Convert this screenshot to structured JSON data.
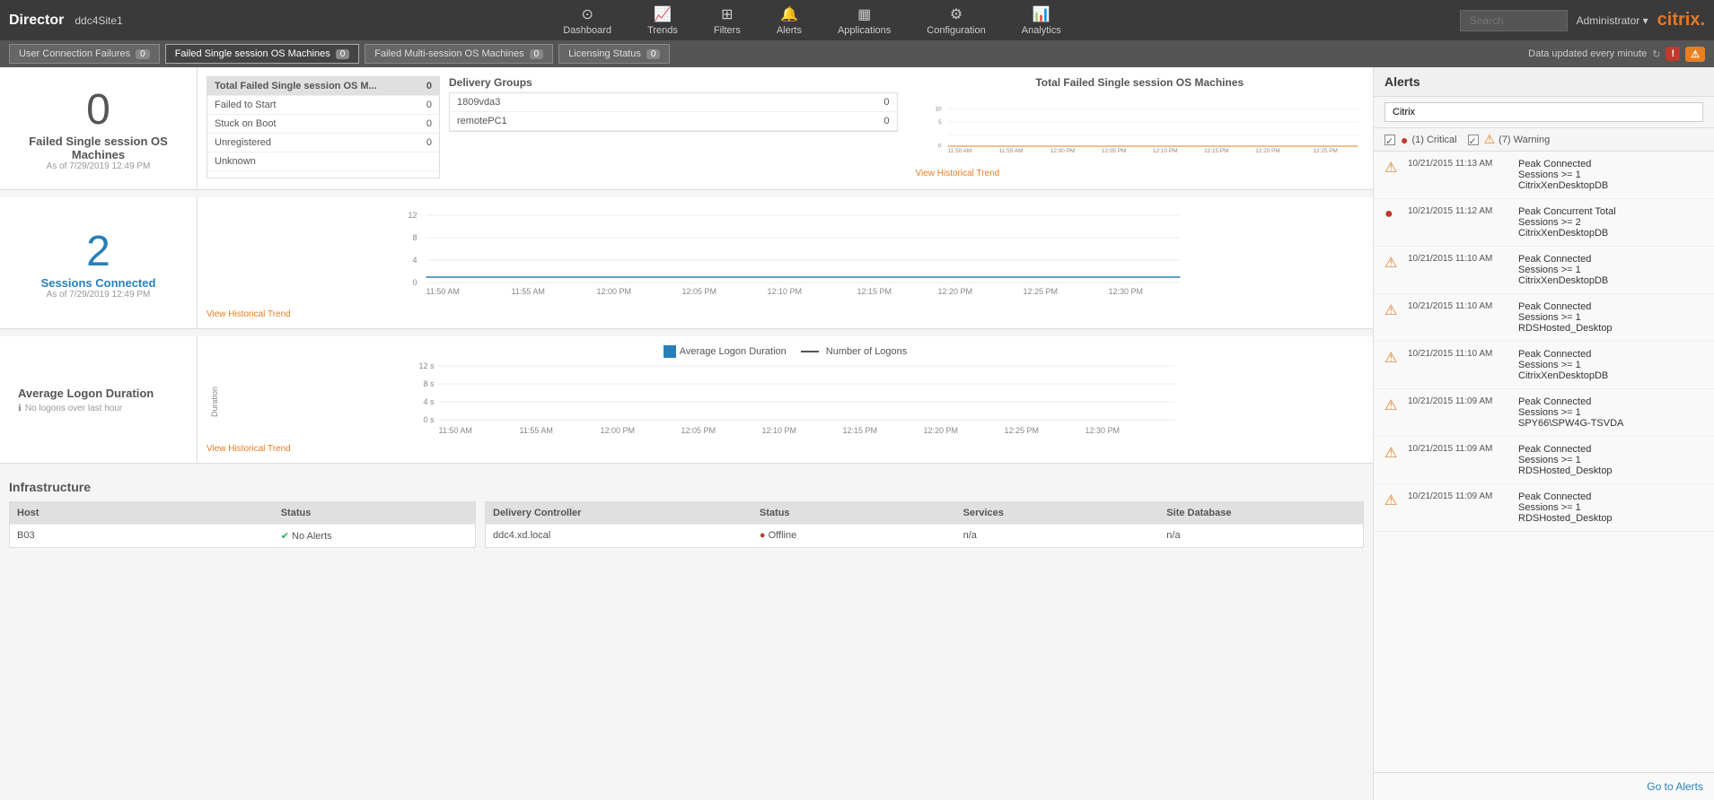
{
  "app": {
    "name": "Director",
    "site": "ddc4Site1",
    "logo": "citrix"
  },
  "nav": {
    "items": [
      {
        "id": "dashboard",
        "label": "Dashboard",
        "icon": "⊙"
      },
      {
        "id": "trends",
        "label": "Trends",
        "icon": "📈"
      },
      {
        "id": "filters",
        "label": "Filters",
        "icon": "⊞"
      },
      {
        "id": "alerts",
        "label": "Alerts",
        "icon": "🔔"
      },
      {
        "id": "applications",
        "label": "Applications",
        "icon": "▦"
      },
      {
        "id": "configuration",
        "label": "Configuration",
        "icon": "⚙"
      },
      {
        "id": "analytics",
        "label": "Analytics",
        "icon": "📊"
      }
    ],
    "search_placeholder": "Search",
    "admin_label": "Administrator ▾"
  },
  "status_bar": {
    "items": [
      {
        "label": "User Connection Failures",
        "count": "0"
      },
      {
        "label": "Failed Single session OS Machines",
        "count": "0",
        "active": true
      },
      {
        "label": "Failed Multi-session OS Machines",
        "count": "0"
      },
      {
        "label": "Licensing Status",
        "count": "0"
      }
    ],
    "data_updated": "Data updated every minute",
    "refresh_icon": "↻"
  },
  "failed_panel": {
    "big_number": "0",
    "title": "Failed Single session OS Machines",
    "date": "As of 7/29/2019 12:49 PM",
    "table": {
      "rows": [
        {
          "label": "Total Failed Single session OS M...",
          "value": "0",
          "highlight": true
        },
        {
          "label": "Failed to Start",
          "value": "0"
        },
        {
          "label": "Stuck on Boot",
          "value": "0"
        },
        {
          "label": "Unregistered",
          "value": "0"
        },
        {
          "label": "Unknown",
          "value": ""
        }
      ]
    },
    "delivery_groups": {
      "title": "Delivery Groups",
      "rows": [
        {
          "name": "1809vda3",
          "value": "0"
        },
        {
          "name": "remotePC1",
          "value": "0"
        }
      ]
    },
    "chart": {
      "title": "Total Failed Single session OS Machines",
      "view_link": "View Historical Trend",
      "x_labels": [
        "11:50 AM",
        "11:55 AM",
        "12:00 PM",
        "12:05 PM",
        "12:10 PM",
        "12:15 PM",
        "12:20 PM",
        "12:25 PM",
        ""
      ],
      "y_labels": [
        "10",
        "5",
        "0"
      ],
      "data_points": []
    }
  },
  "sessions_panel": {
    "big_number": "2",
    "title": "Sessions Connected",
    "date": "As of 7/29/2019 12:49 PM",
    "chart": {
      "view_link": "View Historical Trend",
      "x_labels": [
        "11:50 AM",
        "11:55 AM",
        "12:00 PM",
        "12:05 PM",
        "12:10 PM",
        "12:15 PM",
        "12:20 PM",
        "12:25 PM",
        "12:30 PM"
      ],
      "y_labels": [
        "12",
        "8",
        "4",
        "0"
      ]
    }
  },
  "logon_panel": {
    "title": "Average Logon Duration",
    "info": "No logons over last hour",
    "legend": {
      "avg_label": "Average Logon Duration",
      "num_label": "Number of Logons"
    },
    "chart": {
      "view_link": "View Historical Trend",
      "x_labels": [
        "11:50 AM",
        "11:55 AM",
        "12:00 PM",
        "12:05 PM",
        "12:10 PM",
        "12:15 PM",
        "12:20 PM",
        "12:25 PM",
        "12:30 PM"
      ],
      "y_labels": [
        "12 s",
        "8 s",
        "4 s",
        "0 s"
      ]
    }
  },
  "infrastructure": {
    "title": "Infrastructure",
    "host_table": {
      "columns": [
        "Host",
        "Status"
      ],
      "rows": [
        {
          "host": "B03",
          "status_ok": true,
          "status_text": "No Alerts"
        }
      ]
    },
    "dc_table": {
      "columns": [
        "Delivery Controller",
        "Status",
        "Services",
        "Site Database"
      ],
      "rows": [
        {
          "controller": "ddc4.xd.local",
          "status_ok": false,
          "status_text": "Offline",
          "services": "n/a",
          "site_db": "n/a"
        }
      ]
    }
  },
  "alerts_panel": {
    "title": "Alerts",
    "filter_placeholder": "Citrix",
    "legend": {
      "critical_count": "(1) Critical",
      "warning_count": "(7) Warning"
    },
    "items": [
      {
        "type": "warning",
        "time": "10/21/2015 11:13 AM",
        "desc": "Peak Connected Sessions >= 1\nCitrixXenDesktopDB"
      },
      {
        "type": "critical",
        "time": "10/21/2015 11:12 AM",
        "desc": "Peak Concurrent Total Sessions >= 2\nCitrixXenDesktopDB"
      },
      {
        "type": "warning",
        "time": "10/21/2015 11:10 AM",
        "desc": "Peak Connected Sessions >= 1\nCitrixXenDesktopDB"
      },
      {
        "type": "warning",
        "time": "10/21/2015 11:10 AM",
        "desc": "Peak Connected Sessions >= 1\nRDSHosted_Desktop"
      },
      {
        "type": "warning",
        "time": "10/21/2015 11:10 AM",
        "desc": "Peak Connected Sessions >= 1\nCitrixXenDesktopDB"
      },
      {
        "type": "warning",
        "time": "10/21/2015 11:09 AM",
        "desc": "Peak Connected Sessions >= 1\nSPY66\\SPW4G-TSVDA"
      },
      {
        "type": "warning",
        "time": "10/21/2015 11:09 AM",
        "desc": "Peak Connected Sessions >= 1\nRDSHosted_Desktop"
      },
      {
        "type": "warning",
        "time": "10/21/2015 11:09 AM",
        "desc": "Peak Connected Sessions >= 1\nRDSHosted_Desktop"
      }
    ],
    "footer_link": "Go to Alerts"
  }
}
